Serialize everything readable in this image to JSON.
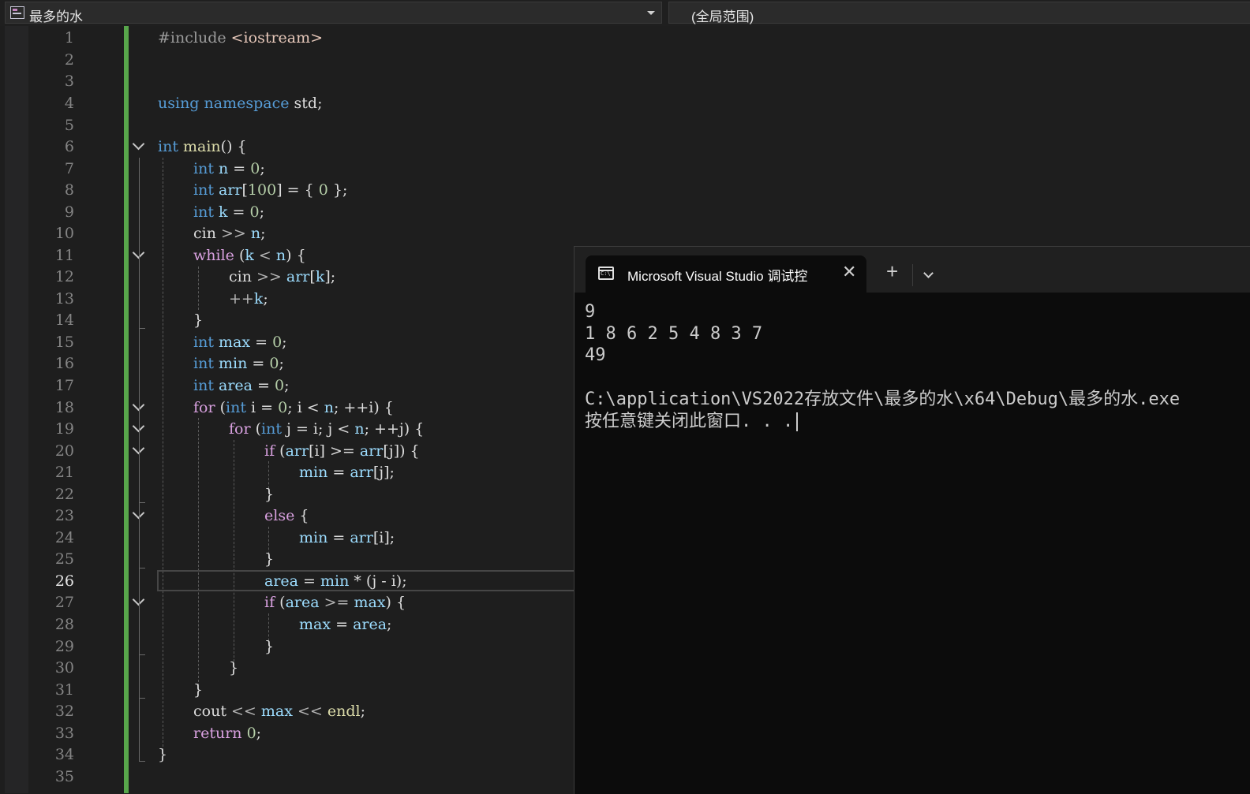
{
  "navbar": {
    "file_name": "最多的水",
    "scope": "(全局范围)"
  },
  "editor": {
    "line_numbers": [
      "1",
      "2",
      "3",
      "4",
      "5",
      "6",
      "7",
      "8",
      "9",
      "10",
      "11",
      "12",
      "13",
      "14",
      "15",
      "16",
      "17",
      "18",
      "19",
      "20",
      "21",
      "22",
      "23",
      "24",
      "25",
      "26",
      "27",
      "28",
      "29",
      "30",
      "31",
      "32",
      "33",
      "34",
      "35"
    ],
    "current_line": "26",
    "code": {
      "l1a": "#include ",
      "l1b": "<iostream>",
      "l4a": "using",
      "l4b": "namespace",
      "l4c": "std;",
      "l6a": "int",
      "l6b": "main",
      "l6c": "() {",
      "l7a": "int",
      "l7b": "n",
      "l7c": " = ",
      "l7d": "0",
      "l7e": ";",
      "l8a": "int",
      "l8b": "arr",
      "l8c": "[",
      "l8d": "100",
      "l8e": "] = { ",
      "l8f": "0",
      "l8g": " };",
      "l9a": "int",
      "l9b": "k",
      "l9c": " = ",
      "l9d": "0",
      "l9e": ";",
      "l10a": "cin",
      "l10b": " >> ",
      "l10c": "n",
      "l10d": ";",
      "l11a": "while",
      "l11b": " (",
      "l11c": "k",
      "l11d": " < ",
      "l11e": "n",
      "l11f": ") {",
      "l12a": "cin",
      "l12b": " >> ",
      "l12c": "arr",
      "l12d": "[",
      "l12e": "k",
      "l12f": "];",
      "l13a": "++",
      "l13b": "k",
      "l13c": ";",
      "l14a": "}",
      "l15a": "int",
      "l15b": "max",
      "l15c": " = ",
      "l15d": "0",
      "l15e": ";",
      "l16a": "int",
      "l16b": "min",
      "l16c": " = ",
      "l16d": "0",
      "l16e": ";",
      "l17a": "int",
      "l17b": "area",
      "l17c": " = ",
      "l17d": "0",
      "l17e": ";",
      "l18a": "for",
      "l18b": " (",
      "l18c": "int",
      "l18d": " i",
      "l18e": " = ",
      "l18f": "0",
      "l18g": "; i < ",
      "l18h": "n",
      "l18i": "; ++i) {",
      "l19a": "for",
      "l19b": " (",
      "l19c": "int",
      "l19d": " j",
      "l19e": " = ",
      "l19f": "i",
      "l19g": "; j < ",
      "l19h": "n",
      "l19i": "; ++j) {",
      "l20a": "if",
      "l20b": " (",
      "l20c": "arr",
      "l20d": "[i] >= ",
      "l20e": "arr",
      "l20f": "[j]) {",
      "l21a": "min",
      "l21b": " = ",
      "l21c": "arr",
      "l21d": "[j];",
      "l22a": "}",
      "l23a": "else",
      "l23b": " {",
      "l24a": "min",
      "l24b": " = ",
      "l24c": "arr",
      "l24d": "[i];",
      "l25a": "}",
      "l26a": "area",
      "l26b": " = ",
      "l26c": "min",
      "l26d": " * (j - i);",
      "l27a": "if",
      "l27b": " (",
      "l27c": "area",
      "l27d": " >= ",
      "l27e": "max",
      "l27f": ") {",
      "l28a": "max",
      "l28b": " = ",
      "l28c": "area",
      "l28d": ";",
      "l29a": "}",
      "l30a": "}",
      "l31a": "}",
      "l32a": "cout",
      "l32b": " << ",
      "l32c": "max",
      "l32d": " << ",
      "l32e": "endl",
      "l32f": ";",
      "l33a": "return",
      "l33b": " ",
      "l33c": "0",
      "l33d": ";",
      "l34a": "}"
    }
  },
  "terminal": {
    "tab_title": "Microsoft Visual Studio 调试控",
    "close_glyph": "✕",
    "new_tab_glyph": "+",
    "lines": [
      "9",
      "1 8 6 2 5 4 8 3 7",
      "49",
      "",
      "C:\\application\\VS2022存放文件\\最多的水\\x64\\Debug\\最多的水.exe",
      "按任意键关闭此窗口. . ."
    ]
  },
  "icons": {
    "file": "cpp-file-icon",
    "dropdown": "chevron-down-icon",
    "fold": "fold-chevron-icon",
    "terminal": "terminal-icon"
  },
  "colors": {
    "keyword": "#569cd6",
    "control": "#d8a0df",
    "function": "#dcdcaa",
    "variable": "#9cdcfe",
    "number": "#b5cea8",
    "change_bar": "#58a64b"
  }
}
